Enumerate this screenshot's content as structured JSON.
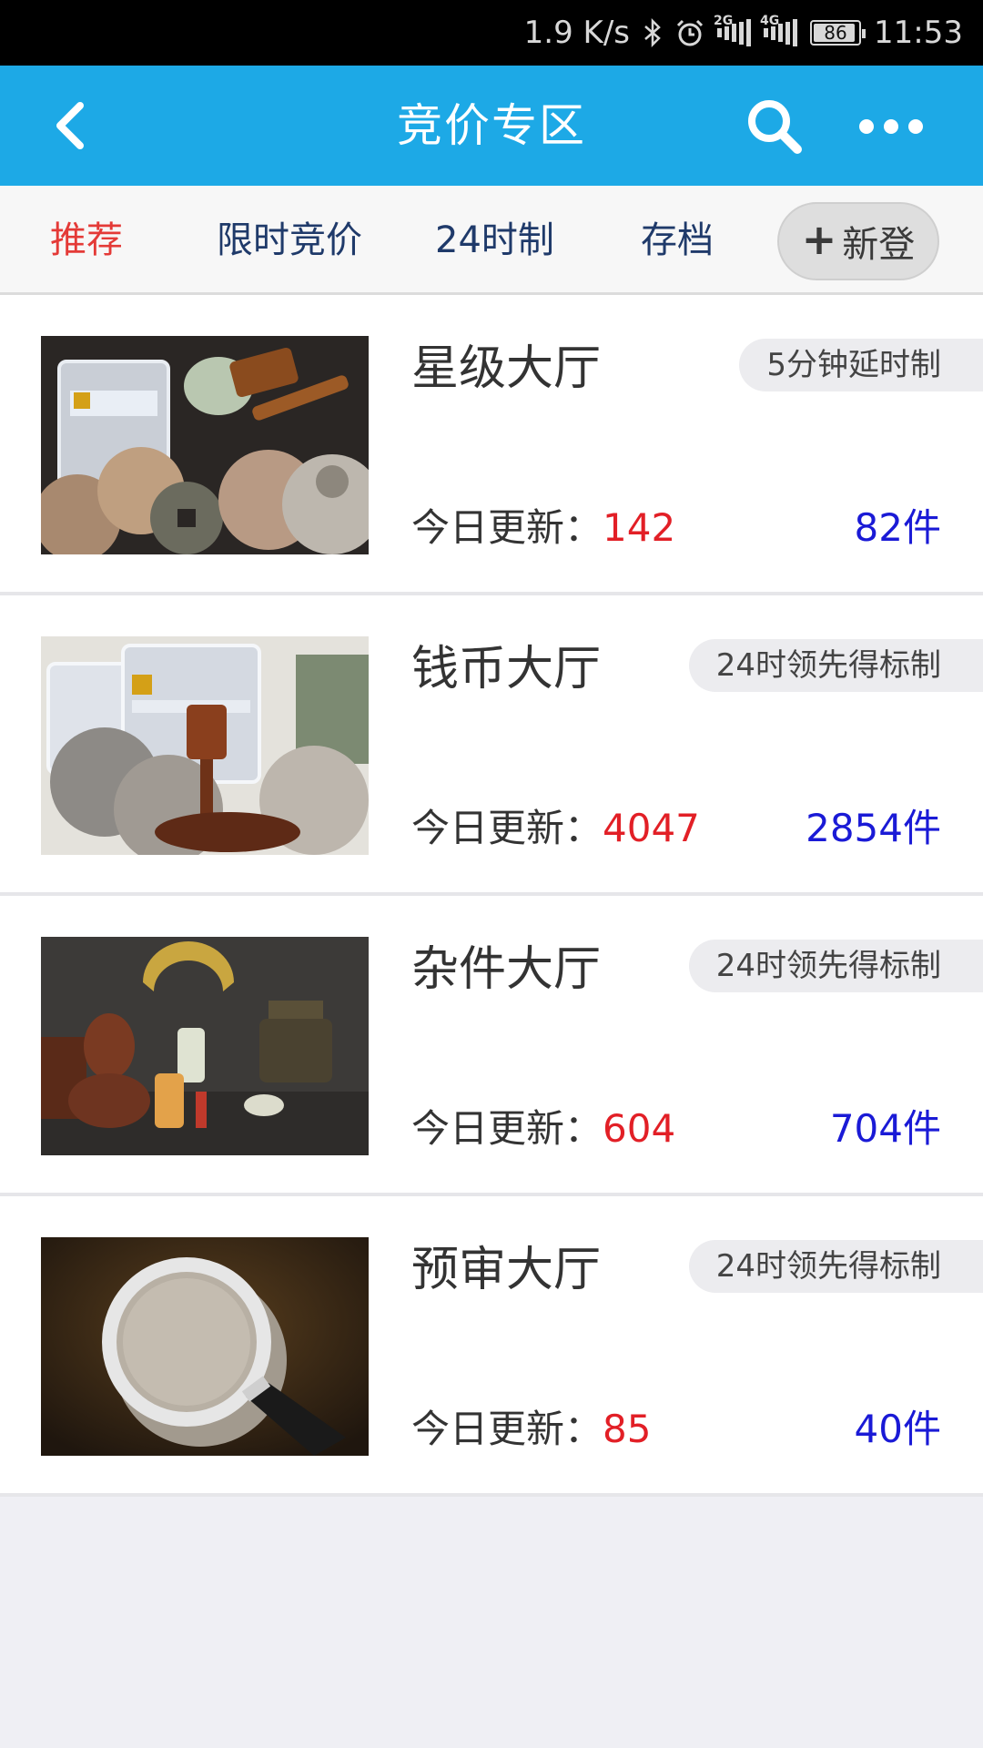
{
  "status_bar": {
    "speed": "1.9 K/s",
    "sim1_tag": "2G",
    "sim2_tag": "4G",
    "battery": "86",
    "time": "11:53",
    "icons": [
      "bluetooth-icon",
      "alarm-icon",
      "signal-icon",
      "signal-icon",
      "battery-icon"
    ]
  },
  "header": {
    "title": "竞价专区",
    "icons": [
      "back-arrow-icon",
      "search-icon",
      "more-icon"
    ],
    "background": "#1da9e6"
  },
  "tabs": {
    "items": [
      {
        "label": "推荐",
        "active": true
      },
      {
        "label": "限时竞价",
        "active": false
      },
      {
        "label": "24时制",
        "active": false
      },
      {
        "label": "存档",
        "active": false
      }
    ],
    "new_button": {
      "plus": "+",
      "label": "新登"
    },
    "active_color": "#e43a37"
  },
  "halls": [
    {
      "name": "星级大厅",
      "badge": "5分钟延时制",
      "update_label": "今日更新：",
      "update_count": "142",
      "items": "82件",
      "image": "coins-and-gavel-thumbnail"
    },
    {
      "name": "钱币大厅",
      "badge": "24时领先得标制",
      "update_label": "今日更新：",
      "update_count": "4047",
      "items": "2854件",
      "image": "graded-coins-thumbnail"
    },
    {
      "name": "杂件大厅",
      "badge": "24时领先得标制",
      "update_label": "今日更新：",
      "update_count": "604",
      "items": "704件",
      "image": "antiques-thumbnail"
    },
    {
      "name": "预审大厅",
      "badge": "24时领先得标制",
      "update_label": "今日更新：",
      "update_count": "85",
      "items": "40件",
      "image": "magnifier-coin-thumbnail"
    }
  ]
}
